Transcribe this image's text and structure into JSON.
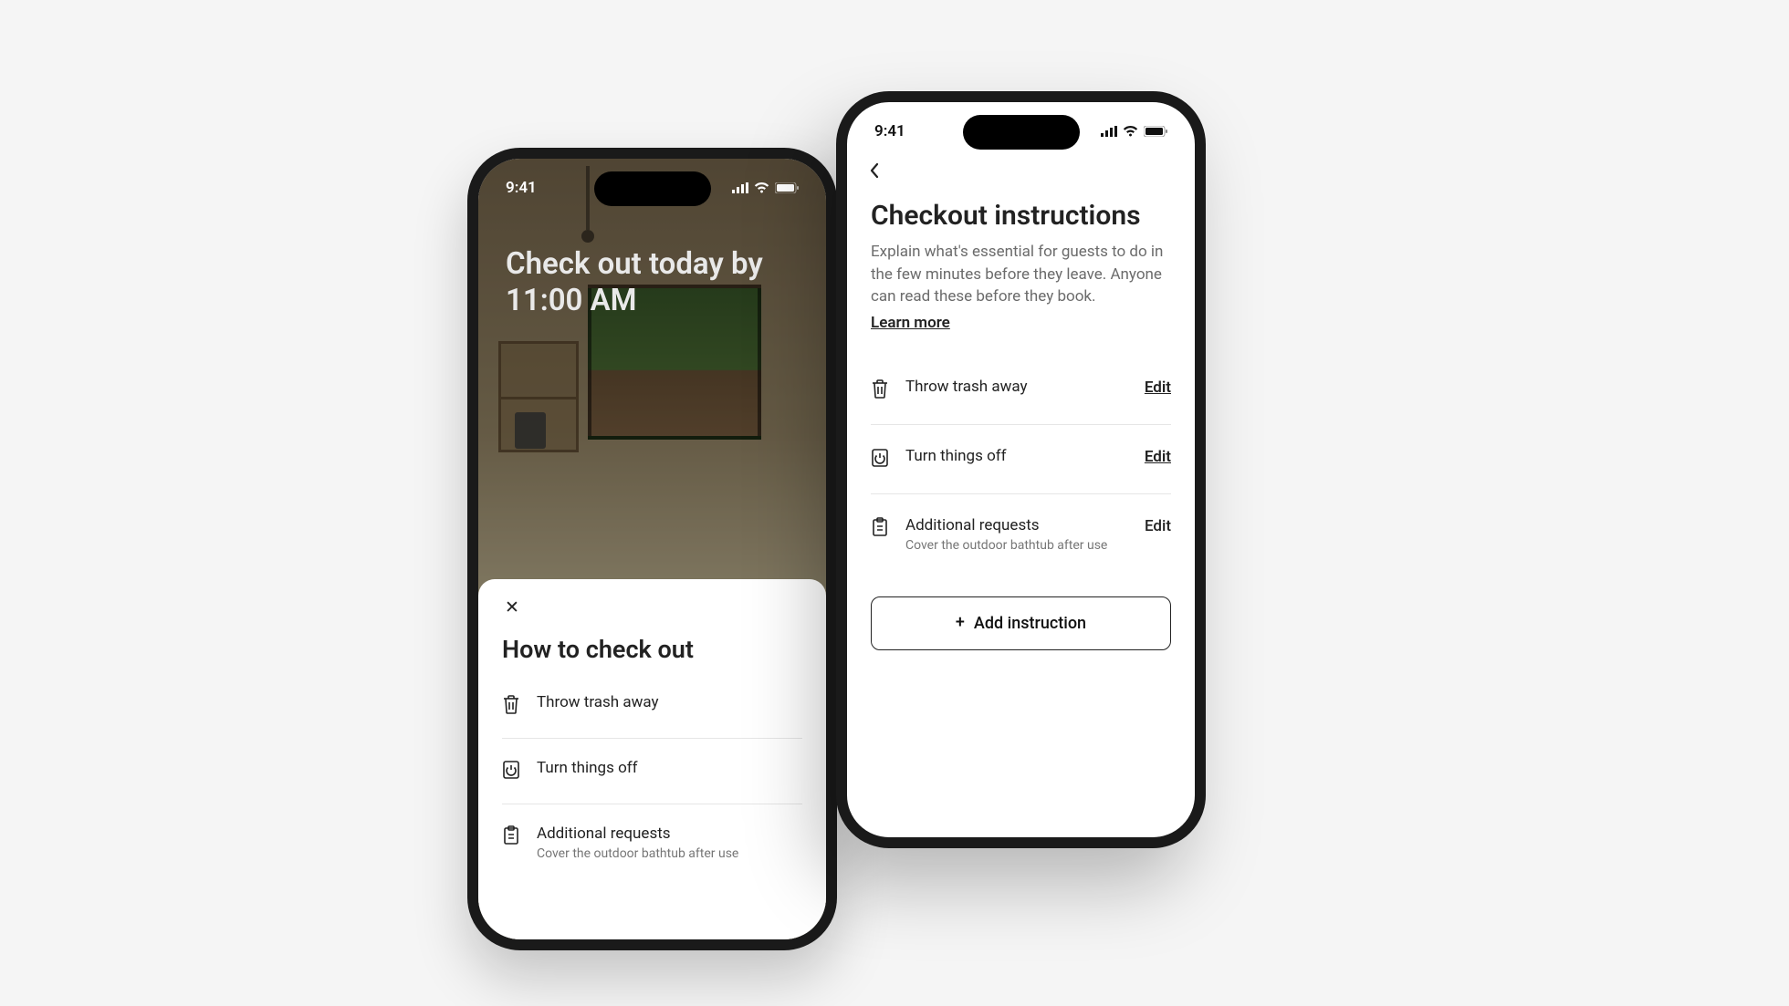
{
  "status": {
    "time": "9:41"
  },
  "back_phone": {
    "headline": "Check out today by 11:00 AM",
    "sheet_title": "How to check out",
    "items": [
      {
        "icon": "trash-icon",
        "label": "Throw trash away"
      },
      {
        "icon": "power-icon",
        "label": "Turn things off"
      },
      {
        "icon": "clipboard-icon",
        "label": "Additional requests",
        "sub": "Cover the outdoor bathtub after use"
      }
    ]
  },
  "front_phone": {
    "title": "Checkout instructions",
    "description": "Explain what's essential for guests to do in the few minutes before they leave. Anyone can read these before they book.",
    "learn_more": "Learn more",
    "edit_label": "Edit",
    "items": [
      {
        "icon": "trash-icon",
        "label": "Throw trash away",
        "edit_underline": true
      },
      {
        "icon": "power-icon",
        "label": "Turn things off",
        "edit_underline": true
      },
      {
        "icon": "clipboard-icon",
        "label": "Additional requests",
        "sub": "Cover the outdoor bathtub after use",
        "edit_underline": false
      }
    ],
    "add_button": "Add instruction"
  }
}
